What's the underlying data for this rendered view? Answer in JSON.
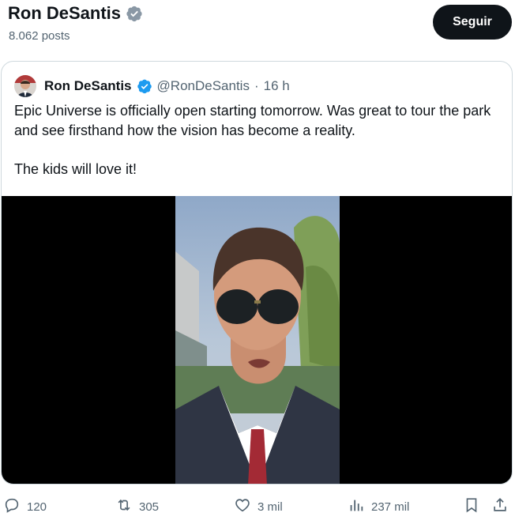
{
  "header": {
    "name": "Ron DeSantis",
    "posts": "8.062 posts",
    "follow_label": "Seguir"
  },
  "quote": {
    "name": "Ron DeSantis",
    "handle": "@RonDeSantis",
    "separator": "·",
    "time": "16 h",
    "text_1": "Epic Universe is officially open starting tomorrow.  Was great to tour the park and see firsthand how the vision has become a reality.",
    "text_2": "The kids will love it!"
  },
  "actions": {
    "replies": "120",
    "reposts": "305",
    "likes": "3 mil",
    "views": "237 mil"
  },
  "colors": {
    "verified": "#1d9bf0",
    "muted_text": "#536471",
    "border": "#cfd9de"
  },
  "icons": [
    "verified-badge-icon",
    "reply-icon",
    "repost-icon",
    "like-icon",
    "views-icon",
    "bookmark-icon",
    "share-icon"
  ]
}
